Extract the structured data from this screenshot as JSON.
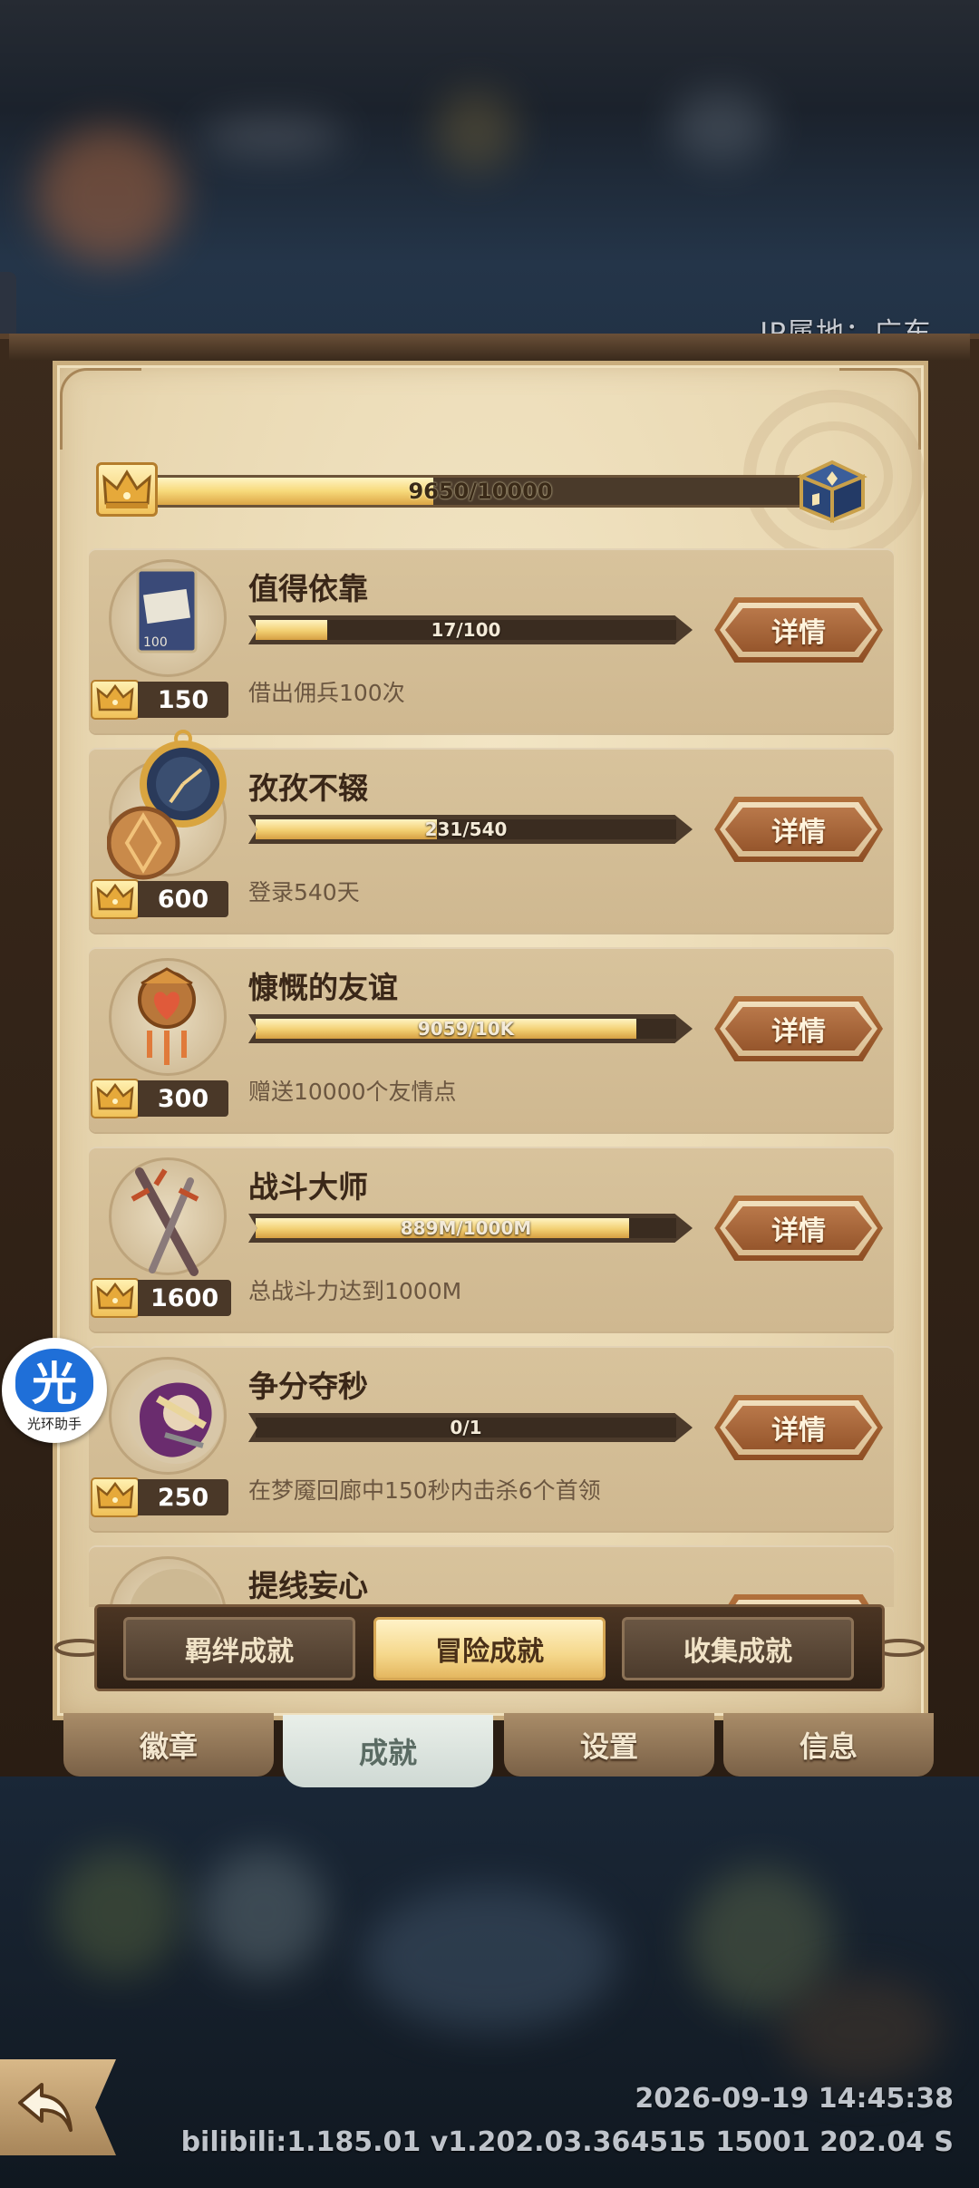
{
  "header": {
    "ip_location": "IP属地：广东"
  },
  "total_progress": {
    "current": 9650,
    "max": 10000,
    "label": "9650/10000",
    "fraction": 0.965
  },
  "achievements": [
    {
      "title": "值得依靠",
      "progress_label": "17/100",
      "fraction": 0.17,
      "description": "借出佣兵100次",
      "points": "150",
      "button": "详情",
      "icon": "card-icon"
    },
    {
      "title": "孜孜不辍",
      "progress_label": "231/540",
      "fraction": 0.43,
      "description": "登录540天",
      "points": "600",
      "button": "详情",
      "icon": "pocket-watch-icon"
    },
    {
      "title": "慷慨的友谊",
      "progress_label": "9059/10K",
      "fraction": 0.906,
      "description": "赠送10000个友情点",
      "points": "300",
      "button": "详情",
      "icon": "heart-amulet-icon"
    },
    {
      "title": "战斗大师",
      "progress_label": "889M/1000M",
      "fraction": 0.889,
      "description": "总战斗力达到1000M",
      "points": "1600",
      "button": "详情",
      "icon": "crossed-swords-icon"
    },
    {
      "title": "争分夺秒",
      "progress_label": "0/1",
      "fraction": 0.0,
      "description": "在梦魇回廊中150秒内击杀6个首领",
      "points": "250",
      "button": "详情",
      "icon": "hero-portrait-icon"
    },
    {
      "title": "提线妄心",
      "progress_label": "",
      "fraction": 0.0,
      "description": "",
      "points": "",
      "button": "详情",
      "icon": "scroll-icon"
    }
  ],
  "sub_tabs": [
    {
      "label": "羁绊成就",
      "active": false
    },
    {
      "label": "冒险成就",
      "active": true
    },
    {
      "label": "收集成就",
      "active": false
    }
  ],
  "main_tabs": [
    {
      "label": "徽章",
      "active": false
    },
    {
      "label": "成就",
      "active": true
    },
    {
      "label": "设置",
      "active": false
    },
    {
      "label": "信息",
      "active": false
    }
  ],
  "assistant": {
    "glyph": "光",
    "label": "光环助手"
  },
  "footer": {
    "timestamp": "2026-09-19 14:45:38",
    "version": "bilibili:1.185.01  v1.202.03.364515 15001 202.04 S"
  },
  "colors": {
    "gold": "#f2cf72",
    "bar_dark": "#3a2c20",
    "parchment": "#e9d8b2",
    "button_brown": "#96562c"
  }
}
